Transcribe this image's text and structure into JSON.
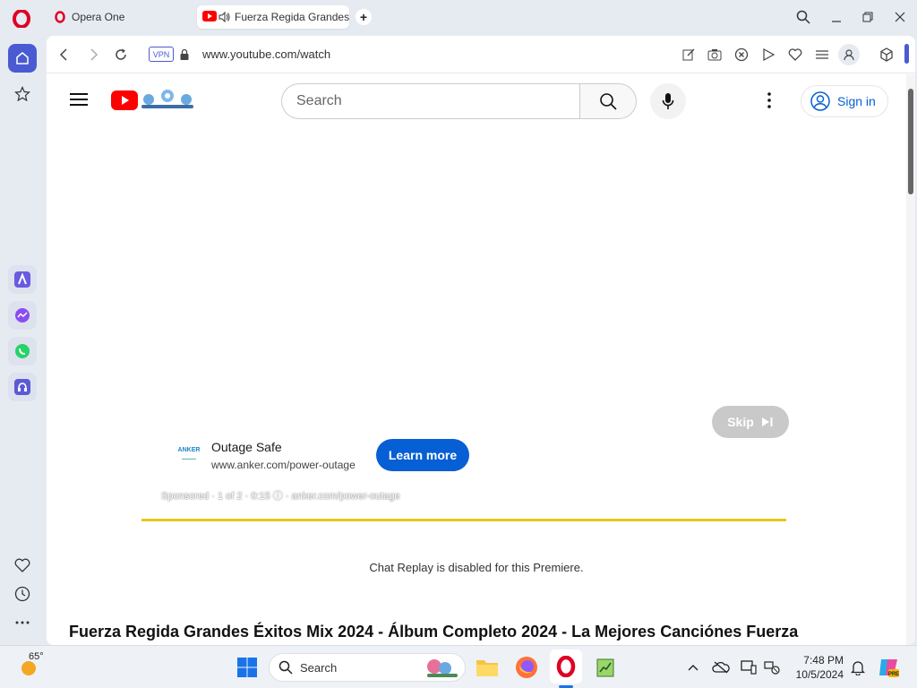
{
  "browser": {
    "inactive_tab_label": "Opera One",
    "active_tab_label": "Fuerza Regida Grandes",
    "url": "www.youtube.com/watch",
    "vpn_label": "VPN"
  },
  "youtube": {
    "search_placeholder": "Search",
    "sign_in_label": "Sign in",
    "ad": {
      "skip_label": "Skip",
      "advertiser_logo_text": "ANKER",
      "title": "Outage Safe",
      "url": "www.anker.com/power-outage",
      "cta_label": "Learn more",
      "sponsored_text": "Sponsored · 1 of 2 · 0:15 ⓘ · anker.com/power-outage"
    },
    "chat_note": "Chat Replay is disabled for this Premiere.",
    "video_title": "Fuerza Regida Grandes Éxitos Mix 2024 - Álbum Completo 2024 - La Mejores Canciónes Fuerza"
  },
  "taskbar": {
    "weather_temp": "65°",
    "search_label": "Search",
    "time": "7:48 PM",
    "date": "10/5/2024"
  },
  "icons": {
    "accent": "#4a5bd1",
    "youtube_red": "#ff0000",
    "opera_red": "#e00024"
  }
}
